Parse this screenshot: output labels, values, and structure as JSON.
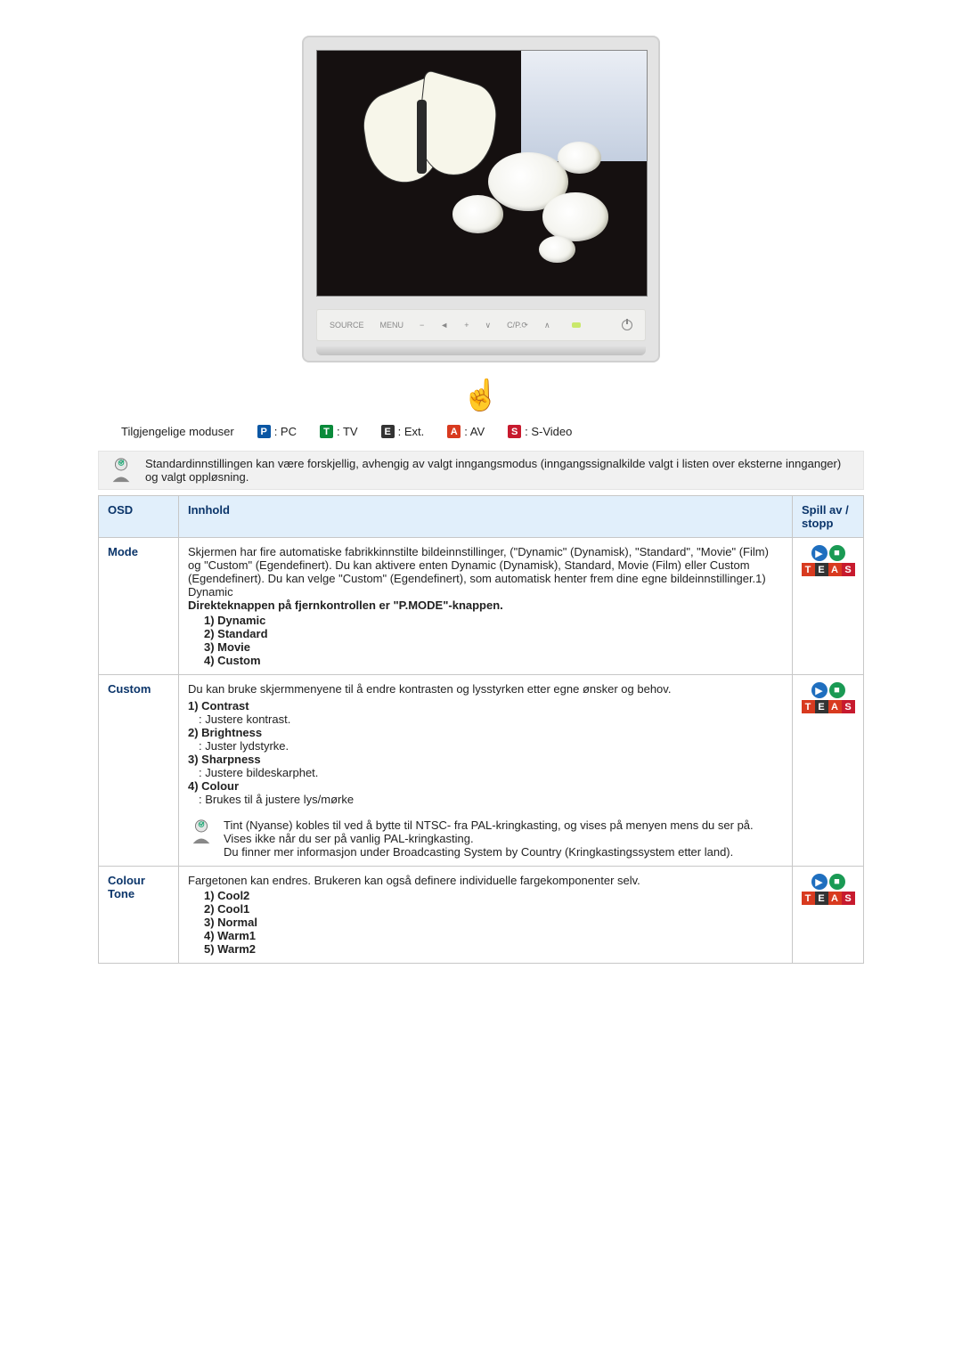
{
  "buttons": {
    "source": "SOURCE",
    "menu": "MENU",
    "minus": "−",
    "vol": "◄",
    "plus": "+",
    "down": "∨",
    "cp": "C/P.⟳",
    "up": "∧"
  },
  "modes": {
    "label": "Tilgjengelige moduser",
    "p": ": PC",
    "t": ": TV",
    "e": ": Ext.",
    "a": ": AV",
    "s": ": S-Video",
    "pL": "P",
    "tL": "T",
    "eL": "E",
    "aL": "A",
    "sL": "S"
  },
  "tip": "Standardinnstillingen kan være forskjellig, avhengig av valgt inngangsmodus (inngangssignalkilde valgt i listen over eksterne innganger) og valgt oppløsning.",
  "headers": {
    "osd": "OSD",
    "innhold": "Innhold",
    "spill": "Spill av / stopp"
  },
  "rows": {
    "mode": {
      "osd": "Mode",
      "text": "Skjermen har fire automatiske fabrikkinnstilte bildeinnstillinger, (\"Dynamic\" (Dynamisk), \"Standard\", \"Movie\" (Film) og \"Custom\" (Egendefinert). Du kan aktivere enten Dynamic (Dynamisk), Standard, Movie (Film) eller Custom (Egendefinert). Du kan velge \"Custom\" (Egendefinert), som automatisk henter frem dine egne bildeinnstillinger.1) Dynamic",
      "b1": "Direkteknappen på fjernkontrollen er \"P.MODE\"-knappen.",
      "l1": "1) Dynamic",
      "l2": "2) Standard",
      "l3": "3) Movie",
      "l4": "4) Custom"
    },
    "custom": {
      "osd": "Custom",
      "intro": "Du kan bruke skjermmenyene til å endre kontrasten og lysstyrken etter egne ønsker og behov.",
      "c1": "1) Contrast",
      "c1d": ": Justere kontrast.",
      "c2": "2) Brightness",
      "c2d": ": Juster lydstyrke.",
      "c3": "3) Sharpness",
      "c3d": ": Justere bildeskarphet.",
      "c4": "4) Colour",
      "c4d": ": Brukes til å justere lys/mørke",
      "tip": "Tint (Nyanse) kobles til ved å bytte til NTSC- fra PAL-kringkasting, og vises på menyen mens du ser på. Vises ikke når du ser på vanlig PAL-kringkasting.\nDu finner mer informasjon under Broadcasting System by Country (Kringkastingssystem etter land)."
    },
    "ctone": {
      "osd": "Colour Tone",
      "text": "Fargetonen kan endres. Brukeren kan også definere individuelle fargekomponenter selv.",
      "l1": "1) Cool2",
      "l2": "2) Cool1",
      "l3": "3) Normal",
      "l4": "4) Warm1",
      "l5": "5) Warm2"
    }
  }
}
